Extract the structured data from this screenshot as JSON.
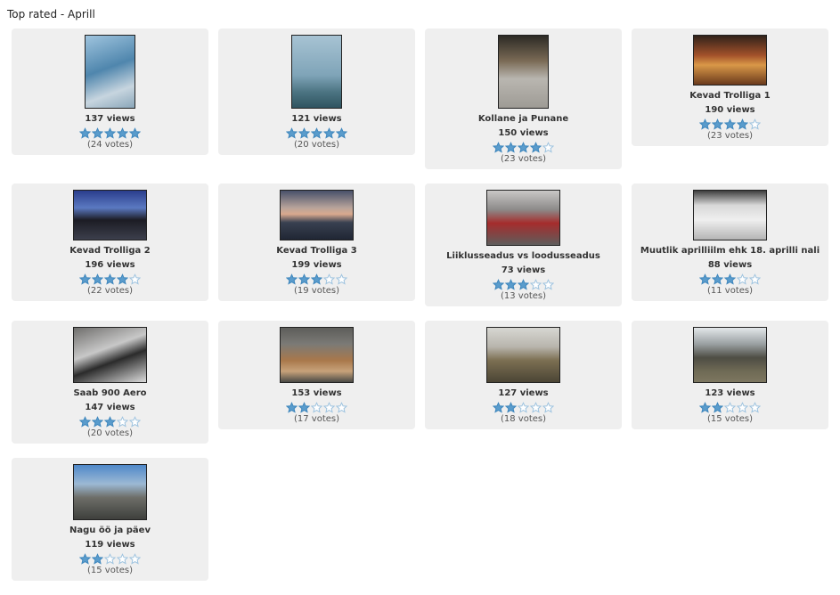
{
  "page": {
    "title": "Top rated - Aprill"
  },
  "colors": {
    "star_fill": "#5a9ccc",
    "star_empty": "#ffffff",
    "star_stroke": "#3f87bd",
    "card_bg": "#efefef"
  },
  "items": [
    {
      "caption": "",
      "views": "137 views",
      "votes": "(24 votes)",
      "rating": 5,
      "thumb": {
        "bg": "linear-gradient(160deg,#9fc4de 0%,#4f86ad 45%,#c7d5df 75%,#8aa6b9 100%)"
      }
    },
    {
      "caption": "",
      "views": "121 views",
      "votes": "(20 votes)",
      "rating": 5,
      "thumb": {
        "bg": "linear-gradient(180deg,#a7c3d3 0%,#7fa4b8 55%,#4c7482 78%,#2f5460 100%)"
      }
    },
    {
      "caption": "Kollane ja Punane",
      "views": "150 views",
      "votes": "(23 votes)",
      "rating": 4,
      "thumb": {
        "bg": "linear-gradient(180deg,#2c2a25 0%,#7a6a55 35%,#b9b6b0 60%,#9e9b95 100%)"
      }
    },
    {
      "caption": "Kevad Trolliga 1",
      "views": "190 views",
      "votes": "(23 votes)",
      "rating": 4,
      "thumb": {
        "bg": "linear-gradient(180deg,#30221a 0%,#a2512a 40%,#d99848 60%,#6b3a1c 100%)"
      }
    },
    {
      "caption": "Kevad Trolliga 2",
      "views": "196 views",
      "votes": "(22 votes)",
      "rating": 4,
      "thumb": {
        "bg": "linear-gradient(180deg,#2a3d8c 0%,#5b79c1 35%,#1c1c24 60%,#3c3f4c 100%)"
      }
    },
    {
      "caption": "Kevad Trolliga 3",
      "views": "199 views",
      "votes": "(19 votes)",
      "rating": 3,
      "thumb": {
        "bg": "linear-gradient(180deg,#47506a 0%,#b7a39a 35%,#d9a98e 48%,#394151 65%,#202634 100%)"
      }
    },
    {
      "caption": "Liiklusseadus vs loodusseadus",
      "views": "73 views",
      "votes": "(13 votes)",
      "rating": 3,
      "thumb": {
        "bg": "linear-gradient(180deg,#c9c7c6 0%,#8c8a89 35%,#a52c2c 60%,#5e5d5c 100%)"
      }
    },
    {
      "caption": "Muutlik aprilliilm ehk 18. aprilli nali",
      "views": "88 views",
      "votes": "(11 votes)",
      "rating": 3,
      "thumb": {
        "bg": "linear-gradient(180deg,#3d3d3d 0%,#d8d8d8 30%,#efefef 60%,#b4b4b4 100%)"
      }
    },
    {
      "caption": "Saab 900 Aero",
      "views": "147 views",
      "votes": "(20 votes)",
      "rating": 3,
      "thumb": {
        "bg": "linear-gradient(160deg,#6f6e6c 0%,#c8c8c8 40%,#2b2b2b 60%,#dcdcdc 100%)"
      }
    },
    {
      "caption": "",
      "views": "153 views",
      "votes": "(17 votes)",
      "rating": 2,
      "thumb": {
        "bg": "linear-gradient(180deg,#5d5d5a 0%,#7b7a76 30%,#a9784b 60%,#c7a27a 80%,#4a4a46 100%)"
      }
    },
    {
      "caption": "",
      "views": "127 views",
      "votes": "(18 votes)",
      "rating": 2,
      "thumb": {
        "bg": "linear-gradient(180deg,#d7d7d2 0%,#b8b5ad 35%,#7c6f52 60%,#4b4535 100%)"
      }
    },
    {
      "caption": "",
      "views": "123 views",
      "votes": "(15 votes)",
      "rating": 2,
      "thumb": {
        "bg": "linear-gradient(180deg,#e3e7ea 0%,#9aa0a2 30%,#4e4d44 55%,#6f6a55 80%,#7d7760 100%)"
      }
    },
    {
      "caption": "Nagu öö ja päev",
      "views": "119 views",
      "votes": "(15 votes)",
      "rating": 2,
      "thumb": {
        "bg": "linear-gradient(180deg,#4f88c9 0%,#9cb9d4 35%,#6d6e68 60%,#3e3f3c 100%)"
      }
    }
  ]
}
